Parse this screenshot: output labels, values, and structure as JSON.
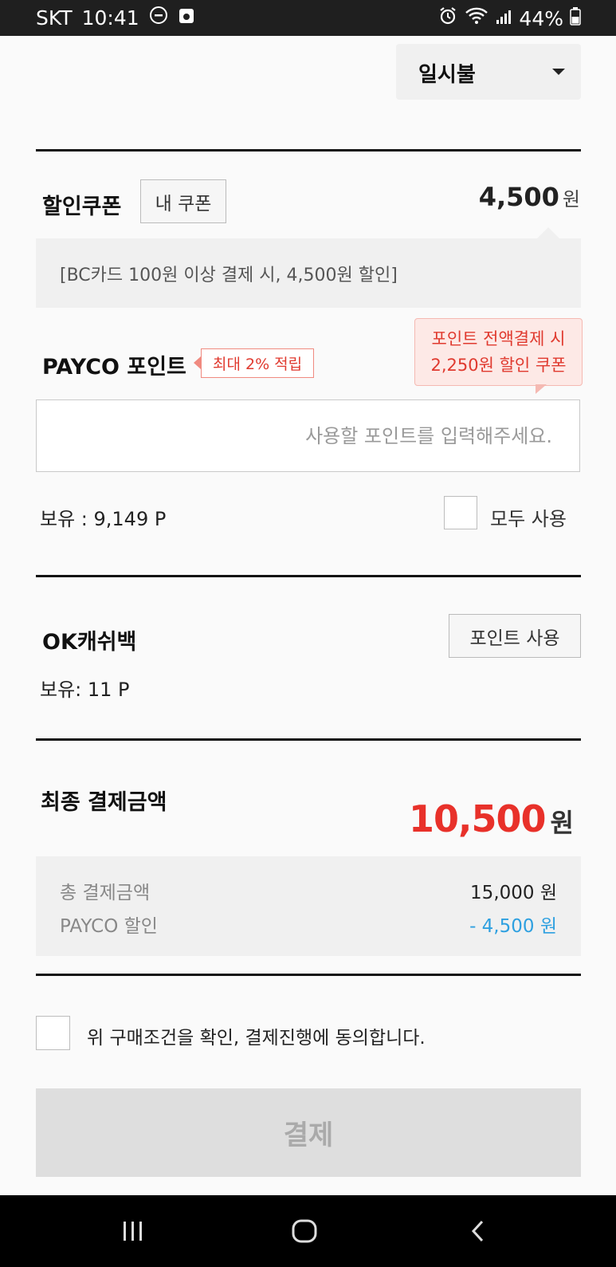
{
  "status_bar": {
    "carrier": "SKT",
    "time": "10:41",
    "battery": "44%"
  },
  "installment": {
    "selected": "일시불"
  },
  "coupon": {
    "title": "할인쿠폰",
    "my_coupon_button": "내 쿠폰",
    "amount": "4,500",
    "currency": "원",
    "description": "[BC카드 100원 이상 결제 시, 4,500원 할인]"
  },
  "payco_point": {
    "title": "PAYCO 포인트",
    "badge": "최대 2% 적립",
    "tooltip_line1": "포인트 전액결제 시",
    "tooltip_line2": "2,250원 할인 쿠폰",
    "input_placeholder": "사용할 포인트를 입력해주세요.",
    "balance": "보유 : 9,149 P",
    "use_all_label": "모두 사용"
  },
  "ok_cashbag": {
    "title": "OK캐쉬백",
    "use_button": "포인트 사용",
    "balance": "보유: 11 P"
  },
  "final": {
    "title": "최종 결제금액",
    "amount": "10,500",
    "currency": "원",
    "rows": [
      {
        "label": "총 결제금액",
        "value": "15,000 원"
      },
      {
        "label": "PAYCO 할인",
        "value": "- 4,500 원"
      }
    ]
  },
  "agreement": {
    "text": "위 구매조건을 확인, 결제진행에 동의합니다."
  },
  "pay_button": {
    "label": "결제"
  },
  "colors": {
    "accent_red": "#e8312a",
    "discount_blue": "#2ea0e0"
  }
}
